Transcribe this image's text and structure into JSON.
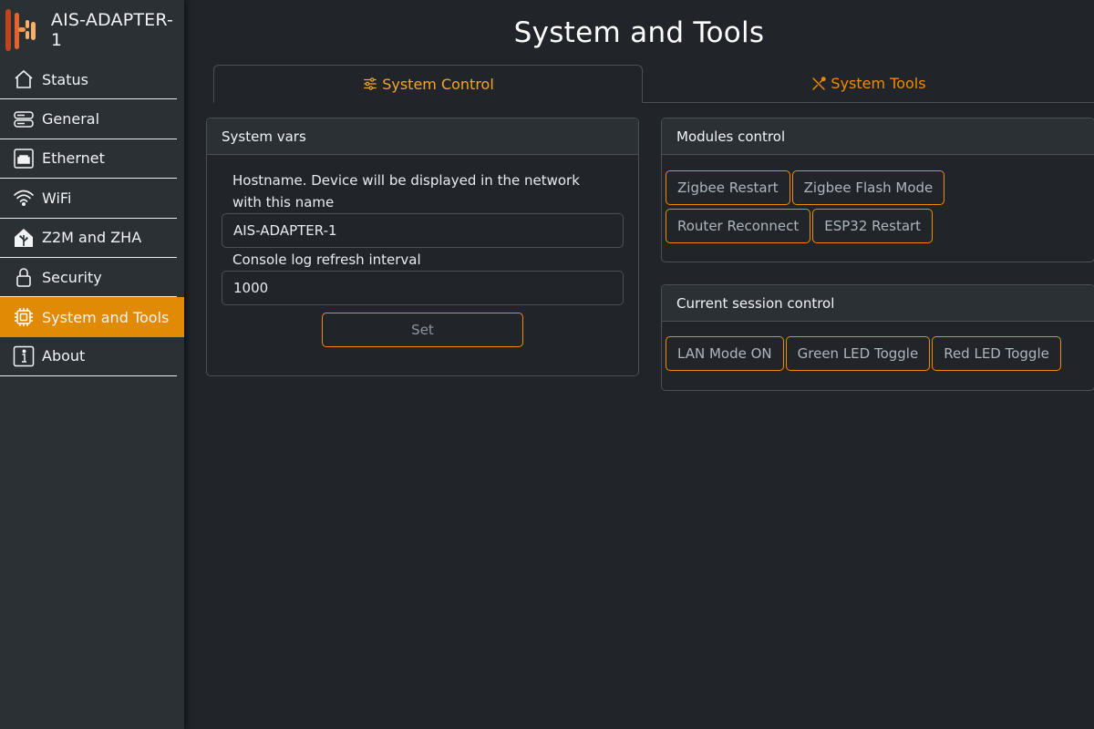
{
  "brand": {
    "name": "AIS-ADAPTER-1",
    "logo_icon": "ais-logo-icon"
  },
  "colors": {
    "accent": "#e18a06",
    "outline": "#f08c00",
    "background": "#212529",
    "sidebar": "#2b3035"
  },
  "sidebar": {
    "items": [
      {
        "label": "Status",
        "icon": "house-icon"
      },
      {
        "label": "General",
        "icon": "server-icon"
      },
      {
        "label": "Ethernet",
        "icon": "ethernet-icon"
      },
      {
        "label": "WiFi",
        "icon": "wifi-icon"
      },
      {
        "label": "Z2M and ZHA",
        "icon": "home-assistant-icon"
      },
      {
        "label": "Security",
        "icon": "lock-icon"
      },
      {
        "label": "System and Tools",
        "icon": "cpu-icon",
        "active": true
      },
      {
        "label": "About",
        "icon": "info-icon"
      }
    ]
  },
  "main": {
    "title": "System and Tools",
    "tabs": [
      {
        "label": "System Control",
        "icon": "sliders-icon",
        "active": true
      },
      {
        "label": "System Tools",
        "icon": "tools-icon"
      }
    ],
    "system_vars": {
      "header": "System vars",
      "hostname_label": "Hostname. Device will be displayed in the network with this name",
      "hostname_value": "AIS-ADAPTER-1",
      "refresh_label": "Console log refresh interval",
      "refresh_value": "1000",
      "set_label": "Set"
    },
    "modules_control": {
      "header": "Modules control",
      "buttons": [
        "Zigbee Restart",
        "Zigbee Flash Mode",
        "Router Reconnect",
        "ESP32 Restart"
      ]
    },
    "session_control": {
      "header": "Current session control",
      "buttons": [
        "LAN Mode ON",
        "Green LED Toggle",
        "Red LED Toggle"
      ]
    }
  }
}
